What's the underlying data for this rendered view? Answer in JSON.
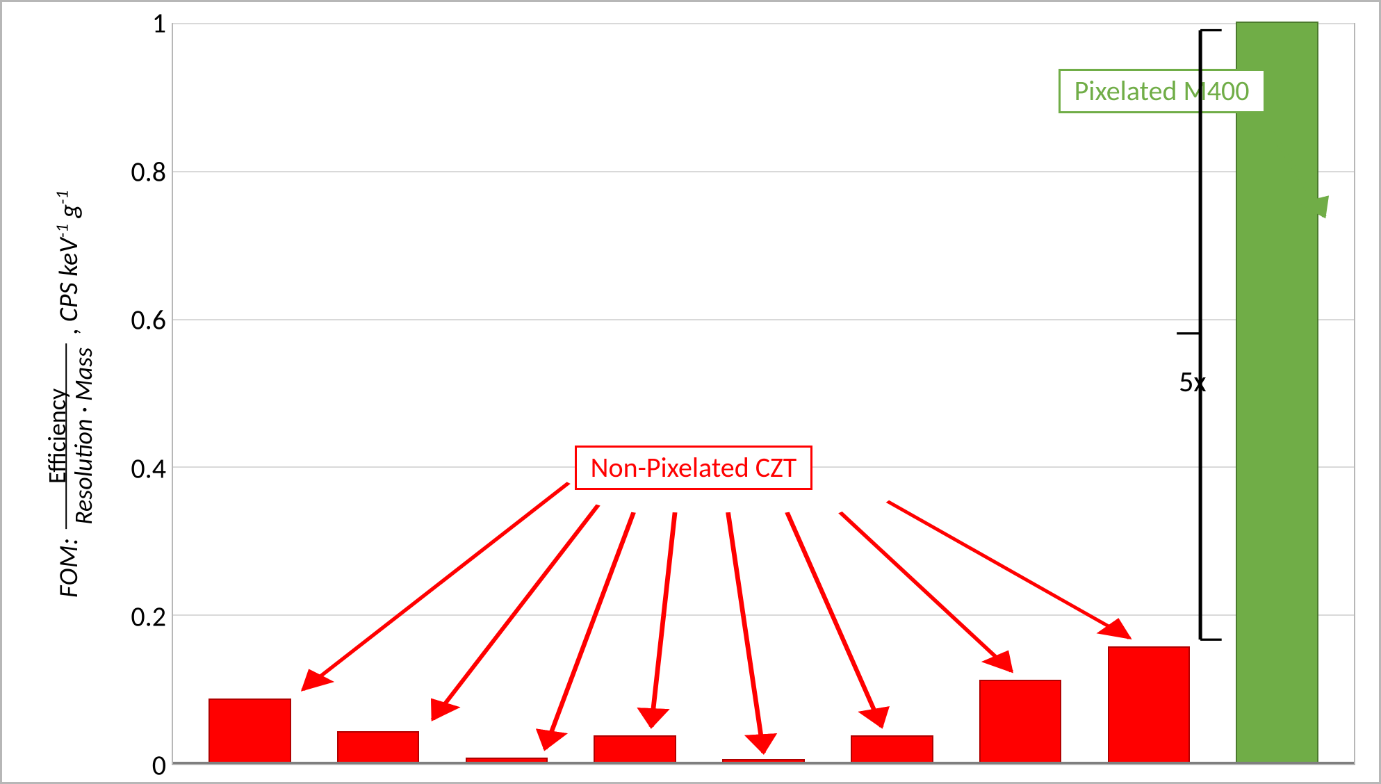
{
  "chart_data": {
    "type": "bar",
    "categories": [
      "",
      "",
      "",
      "",
      "",
      "",
      "",
      "",
      ""
    ],
    "series_group_label_red": "Non-Pixelated CZT",
    "series_group_label_green": "Pixelated M400",
    "values": [
      0.085,
      0.04,
      0.005,
      0.035,
      0.003,
      0.035,
      0.11,
      0.155,
      1.0
    ],
    "group": [
      "red",
      "red",
      "red",
      "red",
      "red",
      "red",
      "red",
      "red",
      "green"
    ],
    "ylim": [
      0,
      1
    ],
    "yticks": [
      0,
      0.2,
      0.4,
      0.6,
      0.8,
      1
    ],
    "ylabel_lead": "FOM:",
    "ylabel_numerator": "Efficiency",
    "ylabel_denominator": "Resolution · Mass",
    "ylabel_units_html": ", CPS keV⁻¹ g⁻¹",
    "bracket_label": "5x"
  },
  "annotations": {
    "red_box_text": "Non-Pixelated CZT",
    "green_box_text": "Pixelated M400",
    "fivex_text": "5x"
  },
  "tick_labels": {
    "t0": "0",
    "t2": "0.2",
    "t4": "0.4",
    "t6": "0.6",
    "t8": "0.8",
    "t10": "1"
  }
}
